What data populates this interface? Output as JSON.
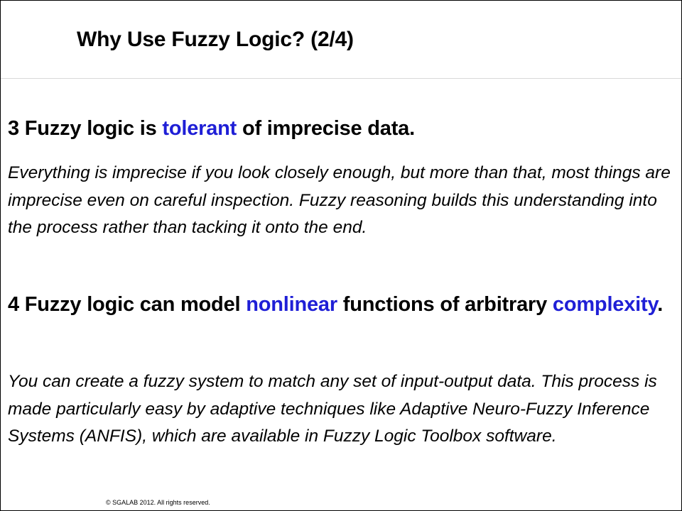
{
  "title": "Why Use Fuzzy Logic? (2/4)",
  "point3": {
    "prefix": "3 Fuzzy logic is ",
    "highlight": "tolerant",
    "suffix": " of imprecise data."
  },
  "desc3": "Everything is imprecise if you look closely enough, but more than that, most things are imprecise even on careful inspection. Fuzzy reasoning builds this understanding into the process rather than tacking it onto the end.",
  "point4": {
    "prefix": "4 Fuzzy logic can model ",
    "highlight1": "nonlinear",
    "middle": " functions of arbitrary ",
    "highlight2": "complexity",
    "suffix": "."
  },
  "desc4": "You can create a fuzzy system to match any set of input-output data. This process is made particularly easy by adaptive techniques like Adaptive Neuro-Fuzzy Inference Systems (ANFIS), which are available in Fuzzy Logic Toolbox software.",
  "footer": "© SGALAB 2012. All rights reserved.",
  "colors": {
    "highlight": "#1f1fd6",
    "text": "#000000"
  }
}
